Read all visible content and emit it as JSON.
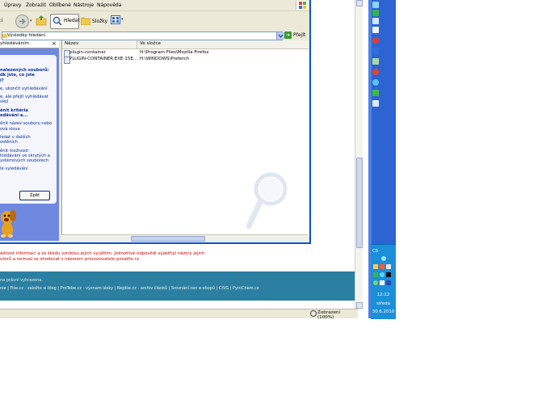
{
  "window": {
    "menu": [
      "Úpravy",
      "Zobrazit",
      "Oblíbené",
      "Nástroje",
      "Nápověda"
    ],
    "toolbar": {
      "search_label": "Hledat",
      "folders_label": "Složky"
    },
    "address": {
      "value": "Výsledky hledání",
      "go_label": "Přejít"
    },
    "pane": {
      "header": "yhledáváním",
      "close": "×",
      "lines": [
        {
          "text": "nalezených souborů:",
          "bold": true
        },
        {
          "text": "dk jste, co jste",
          "bold": true
        },
        {
          "text": "i?",
          "bold": true
        },
        {
          "text": "",
          "bold": false
        },
        {
          "text": "e, ukončit vyhledávání",
          "bold": false
        },
        {
          "text": "",
          "bold": false
        },
        {
          "text": "e, ale přejít vyhledávat",
          "bold": false
        },
        {
          "text": "slejí",
          "bold": false
        },
        {
          "text": "",
          "bold": false
        },
        {
          "text": "ěnit kritéria",
          "bold": true
        },
        {
          "text": "edávání a...",
          "bold": true
        },
        {
          "text": "",
          "bold": false
        },
        {
          "text": "ěnit název souboru nebo",
          "bold": false
        },
        {
          "text": "ová slova",
          "bold": false
        },
        {
          "text": "",
          "bold": false
        },
        {
          "text": "ledat v dalších",
          "bold": false
        },
        {
          "text": "ostěních",
          "bold": false
        },
        {
          "text": "",
          "bold": false
        },
        {
          "text": "ěnit možnosti",
          "bold": false
        },
        {
          "text": "hledávání ve skrytých a",
          "bold": false
        },
        {
          "text": "ystémových souborech",
          "bold": false
        },
        {
          "text": "",
          "bold": false
        },
        {
          "text": "lé vyledávání",
          "bold": false
        }
      ],
      "find_button": "Zpět"
    },
    "results": {
      "columns": [
        "Název",
        "Ve složce"
      ],
      "rows": [
        {
          "name": "plugin-container",
          "folder": "H:\\Program Files\\Mozilla Firefox"
        },
        {
          "name": "PLUGIN-CONTAINER.EXE-15E...",
          "folder": "H:\\WINDOWS\\Prefetch"
        }
      ]
    }
  },
  "page": {
    "notice_lines": [
      "ádnost informací a za škodu vzniklou jejich využitím. Jednotlivé odpovědi vyjadřují názory jejich",
      "utorů a nemusí se shodovat s názorem provozovatele poradte.cz"
    ],
    "footer_line1": "na právní vyhrazena.",
    "footer_line2": "nie | Fiše.cz - založte si blog | ProTebe.cz - význam lásky | Nejdše.cz - archiv článků | Srovnání cen e-shopů | CiVG | PyroChem.cz"
  },
  "statusbar": {
    "zoom": "Zobrazení (100%)"
  },
  "taskbar": {
    "tray_label": "CS",
    "clock_time": "12:12",
    "clock_day": "středa",
    "clock_date": "30.6.2010"
  }
}
